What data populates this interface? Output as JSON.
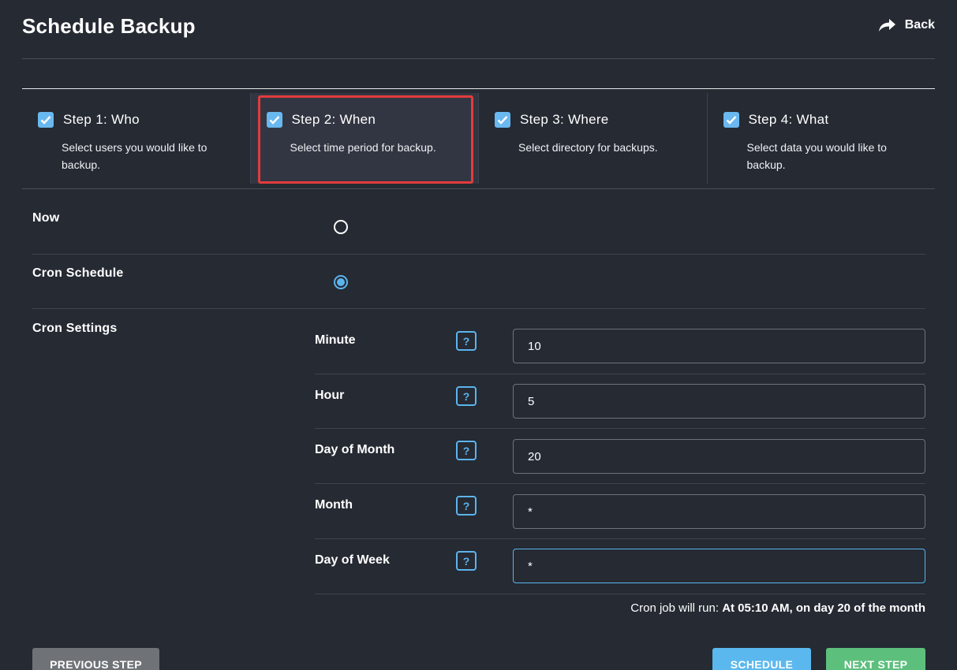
{
  "header": {
    "title": "Schedule Backup",
    "back_label": "Back",
    "back_icon": "share-arrow-icon"
  },
  "steps": [
    {
      "title": "Step 1: Who",
      "description": "Select users you would like to backup.",
      "checked": true,
      "active": false
    },
    {
      "title": "Step 2: When",
      "description": "Select time period for backup.",
      "checked": true,
      "active": true
    },
    {
      "title": "Step 3: Where",
      "description": "Select directory for backups.",
      "checked": true,
      "active": false
    },
    {
      "title": "Step 4: What",
      "description": "Select data you would like to backup.",
      "checked": true,
      "active": false
    }
  ],
  "options": {
    "now_label": "Now",
    "cron_label": "Cron Schedule",
    "selected": "cron",
    "settings_label": "Cron Settings"
  },
  "cron_fields": [
    {
      "label": "Minute",
      "value": "10",
      "help": "?"
    },
    {
      "label": "Hour",
      "value": "5",
      "help": "?"
    },
    {
      "label": "Day of Month",
      "value": "20",
      "help": "?"
    },
    {
      "label": "Month",
      "value": "*",
      "help": "?"
    },
    {
      "label": "Day of Week",
      "value": "*",
      "help": "?"
    }
  ],
  "summary": {
    "prefix": "Cron job will run:",
    "text": "At 05:10 AM, on day 20 of the month"
  },
  "buttons": {
    "previous": "PREVIOUS STEP",
    "schedule": "SCHEDULE",
    "next": "NEXT STEP"
  },
  "colors": {
    "background": "#252a33",
    "accent": "#5cb4ee",
    "highlight": "#e23c3c",
    "next": "#5dbf7c",
    "prev": "#6f7378"
  }
}
